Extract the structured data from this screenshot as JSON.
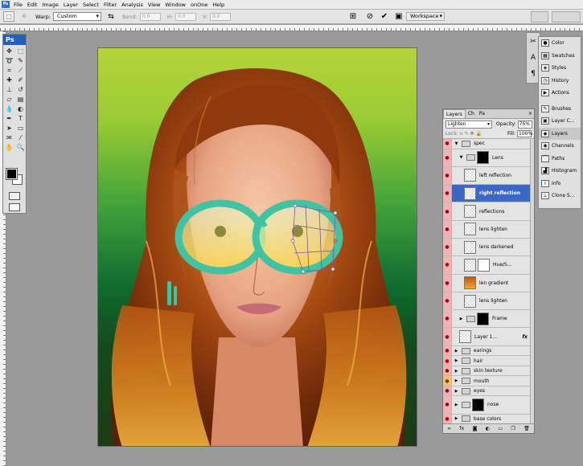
{
  "menu": {
    "items": [
      "File",
      "Edit",
      "Image",
      "Layer",
      "Select",
      "Filter",
      "Analysis",
      "View",
      "Window",
      "onOne",
      "Help"
    ]
  },
  "options": {
    "warp_label": "Warp:",
    "warp_value": "Custom",
    "bend_label": "Bend:",
    "bend_value": "0.0",
    "h_label": "H:",
    "h_value": "0.0",
    "v_label": "V:",
    "v_value": "0.0",
    "workspace": "Workspace"
  },
  "toolbox": {
    "logo": "Ps"
  },
  "right_panels": {
    "items": [
      {
        "label": "Color",
        "icon": "color-icon"
      },
      {
        "label": "Swatches",
        "icon": "swatches-icon"
      },
      {
        "label": "Styles",
        "icon": "styles-icon"
      },
      {
        "label": "History",
        "icon": "history-icon"
      },
      {
        "label": "Actions",
        "icon": "actions-icon"
      },
      {
        "label": "Brushes",
        "icon": "brushes-icon"
      },
      {
        "label": "Layer C...",
        "icon": "layer-comps-icon"
      },
      {
        "label": "Layers",
        "icon": "layers-icon"
      },
      {
        "label": "Channels",
        "icon": "channels-icon"
      },
      {
        "label": "Paths",
        "icon": "paths-icon"
      },
      {
        "label": "Histogram",
        "icon": "histogram-icon"
      },
      {
        "label": "Info",
        "icon": "info-icon"
      },
      {
        "label": "Clone S...",
        "icon": "clone-source-icon"
      }
    ]
  },
  "layers_panel": {
    "tabs": [
      "Layers",
      "Ch",
      "Pa"
    ],
    "blend_mode": "Lighten",
    "opacity_label": "Opacity:",
    "opacity_value": "75%",
    "lock_label": "Lock:",
    "fill_label": "Fill:",
    "fill_value": "100%",
    "layers": [
      {
        "name": "spec",
        "kind": "group",
        "indent": 0
      },
      {
        "name": "Lens",
        "kind": "group-mask",
        "indent": 1
      },
      {
        "name": "left reflection",
        "kind": "layer",
        "indent": 2
      },
      {
        "name": "right reflection",
        "kind": "layer",
        "indent": 2,
        "selected": true
      },
      {
        "name": "reflections",
        "kind": "layer",
        "indent": 2
      },
      {
        "name": "lens lighten",
        "kind": "layer",
        "indent": 2
      },
      {
        "name": "lens darkened",
        "kind": "layer",
        "indent": 2
      },
      {
        "name": "Hue/S...",
        "kind": "adjustment",
        "indent": 2
      },
      {
        "name": "len gradient",
        "kind": "layer",
        "indent": 2
      },
      {
        "name": "lens lighten",
        "kind": "layer",
        "indent": 2
      },
      {
        "name": "Frame",
        "kind": "group-mask",
        "indent": 1
      },
      {
        "name": "Layer 1...",
        "kind": "layer-fx",
        "indent": 1,
        "fx": "fx"
      },
      {
        "name": "earings",
        "kind": "group",
        "indent": 0
      },
      {
        "name": "hair",
        "kind": "group",
        "indent": 0
      },
      {
        "name": "skin texture",
        "kind": "group",
        "indent": 0
      },
      {
        "name": "mouth",
        "kind": "group",
        "indent": 0,
        "eye": "orange"
      },
      {
        "name": "eyes",
        "kind": "group",
        "indent": 0
      },
      {
        "name": "nose",
        "kind": "group-mask",
        "indent": 0
      },
      {
        "name": "base colors",
        "kind": "group",
        "indent": 0
      }
    ]
  },
  "colors": {
    "selection": "#3a68c4",
    "eye_column": "#f1b2b2"
  }
}
